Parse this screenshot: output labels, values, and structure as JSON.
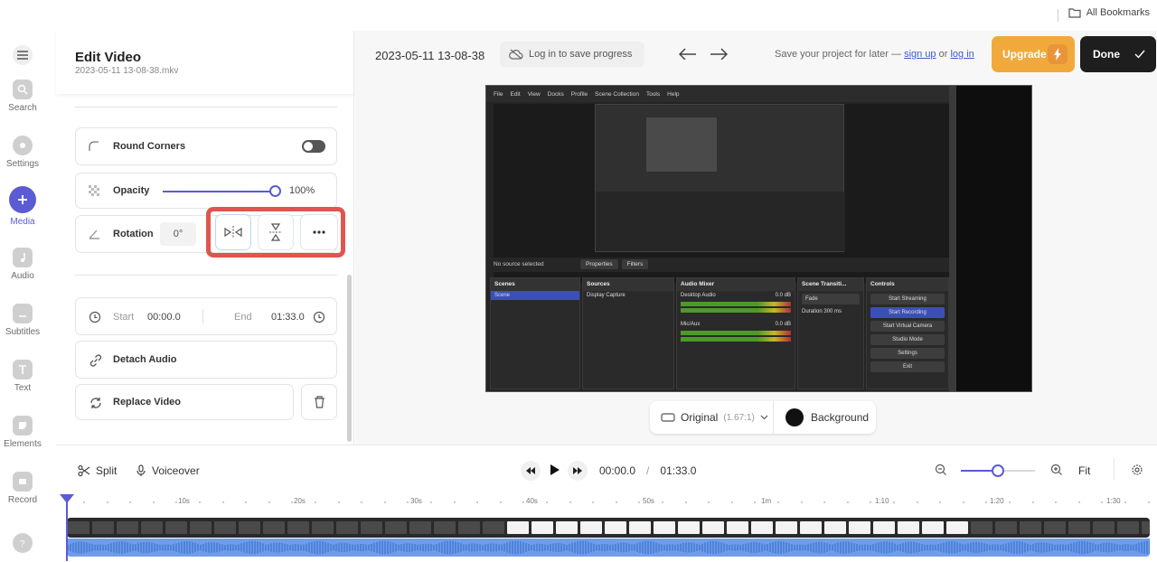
{
  "browser": {
    "bookmarks_label": "All Bookmarks"
  },
  "rail": {
    "items": [
      {
        "label": "Search"
      },
      {
        "label": "Settings"
      },
      {
        "label": "Media"
      },
      {
        "label": "Audio"
      },
      {
        "label": "Subtitles"
      },
      {
        "label": "Text"
      },
      {
        "label": "Elements"
      },
      {
        "label": "Record"
      }
    ]
  },
  "panel": {
    "title": "Edit Video",
    "subtitle": "2023-05-11 13-08-38.mkv",
    "round_corners_label": "Round Corners",
    "opacity_label": "Opacity",
    "opacity_value": "100%",
    "opacity_level": 1.0,
    "rotation_label": "Rotation",
    "rotation_value": "0°",
    "start_label": "Start",
    "start_value": "00:00.0",
    "end_label": "End",
    "end_value": "01:33.0",
    "detach_label": "Detach Audio",
    "replace_label": "Replace Video"
  },
  "header": {
    "project_name": "2023-05-11 13-08-38",
    "save_progress": "Log in to save progress",
    "save_later_prefix": "Save your project for later —",
    "sign_up": "sign up",
    "or_text": "or",
    "log_in": "log in",
    "upgrade": "Upgrade",
    "done": "Done"
  },
  "obs": {
    "menu": [
      "File",
      "Edit",
      "View",
      "Docks",
      "Profile",
      "Scene Collection",
      "Tools",
      "Help"
    ],
    "status": "No source selected",
    "properties_tab": "Properties",
    "filters_tab": "Filters",
    "scenes_title": "Scenes",
    "scene_item": "Scene",
    "sources_title": "Sources",
    "source_item": "Display Capture",
    "mixer_title": "Audio Mixer",
    "desktop_audio": "Desktop Audio",
    "mic_aux": "Mic/Aux",
    "db_value": "0.0 dB",
    "transitions_title": "Scene Transiti...",
    "fade": "Fade",
    "duration_label": "Duration",
    "duration_value": "300 ms",
    "controls_title": "Controls",
    "controls": [
      "Start Streaming",
      "Start Recording",
      "Start Virtual Camera",
      "Studio Mode",
      "Settings",
      "Exit"
    ]
  },
  "canvas_bottom": {
    "ratio_label": "Original",
    "ratio_value": "(1.67:1)",
    "background_label": "Background"
  },
  "timeline": {
    "split": "Split",
    "voiceover": "Voiceover",
    "current_time": "00:00.0",
    "separator": "/",
    "total_time": "01:33.0",
    "fit": "Fit",
    "zoom_level": 0.5,
    "ticks": [
      "10s",
      "20s",
      "30s",
      "40s",
      "50s",
      "1m",
      "1:10",
      "1:20",
      "1:30"
    ]
  },
  "colors": {
    "accent": "#5b5bd6",
    "upgrade": "#f2a93b",
    "done": "#1e1e1e",
    "highlight": "#e0554f",
    "audio_track": "#6f9ee8"
  }
}
